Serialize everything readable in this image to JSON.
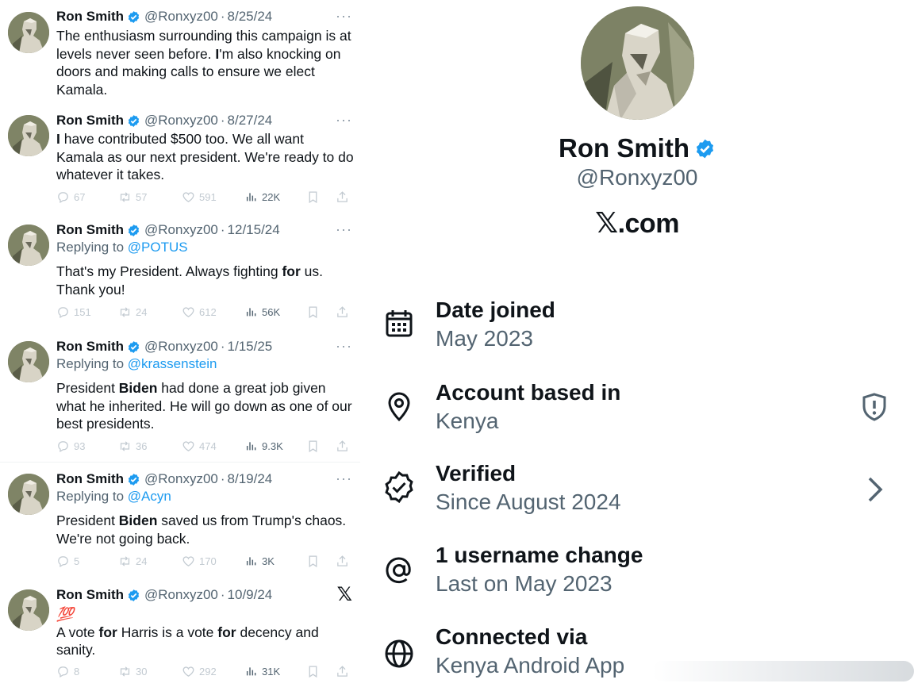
{
  "tweets": [
    {
      "name": "Ron Smith",
      "handle": "@Ronxyz00",
      "date": "8/25/24",
      "replying_prefix": "",
      "replying_to": "",
      "text": [
        "The enthusiasm surrounding this campaign is at",
        "levels never seen before. ",
        "I",
        "'m also knocking on",
        "doors and making calls to ensure we elect",
        "Kamala."
      ],
      "stats": null
    },
    {
      "name": "Ron Smith",
      "handle": "@Ronxyz00",
      "date": "8/27/24",
      "replying_prefix": "",
      "replying_to": "",
      "text": [
        "I",
        " have contributed $500 too. We all want",
        "Kamala as our next president. We're ready to do",
        "whatever it takes."
      ],
      "stats": {
        "replies": "67",
        "reposts": "57",
        "likes": "591",
        "views": "22K"
      }
    },
    {
      "name": "Ron Smith",
      "handle": "@Ronxyz00",
      "date": "12/15/24",
      "replying_prefix": "Replying to",
      "replying_to": "@POTUS",
      "text": [
        "That's my President. Always fighting ",
        "for",
        " us.",
        "Thank you!"
      ],
      "stats": {
        "replies": "151",
        "reposts": "24",
        "likes": "612",
        "views": "56K"
      }
    },
    {
      "name": "Ron Smith",
      "handle": "@Ronxyz00",
      "date": "1/15/25",
      "replying_prefix": "Replying to",
      "replying_to": "@krassenstein",
      "text": [
        "President ",
        "Biden",
        " had done a great job given",
        "what he inherited. He will go down as one of our",
        "best presidents."
      ],
      "stats": {
        "replies": "93",
        "reposts": "36",
        "likes": "474",
        "views": "9.3K"
      }
    },
    {
      "name": "Ron Smith",
      "handle": "@Ronxyz00",
      "date": "8/19/24",
      "replying_prefix": "Replying to",
      "replying_to": "@Acyn",
      "text": [
        "President ",
        "Biden",
        " saved us from Trump's chaos.",
        "We're not going back."
      ],
      "stats": {
        "replies": "5",
        "reposts": "24",
        "likes": "170",
        "views": "3K"
      }
    },
    {
      "name": "Ron Smith",
      "handle": "@Ronxyz00",
      "date": "10/9/24",
      "replying_prefix": "",
      "replying_to": "",
      "emoji": "💯",
      "text": [
        "A vote ",
        "for",
        " Harris is a vote ",
        "for",
        " decency and",
        "sanity."
      ],
      "stats": {
        "replies": "8",
        "reposts": "30",
        "likes": "292",
        "views": "31K"
      }
    }
  ],
  "more_glyph": "···",
  "x_glyph": "𝕏",
  "profile": {
    "name": "Ron Smith",
    "handle": "@Ronxyz00",
    "site_glyph": "𝕏",
    "site_suffix": ".com",
    "rows": [
      {
        "icon": "calendar-icon",
        "title": "Date joined",
        "value": "May 2023"
      },
      {
        "icon": "location-pin-icon",
        "title": "Account based in",
        "value": "Kenya"
      },
      {
        "icon": "verified-badge-icon",
        "title": "Verified",
        "value": "Since August 2024"
      },
      {
        "icon": "at-sign-icon",
        "title": "1 username change",
        "value": "Last on May 2023"
      },
      {
        "icon": "globe-icon",
        "title": "Connected via",
        "value": "Kenya Android App"
      }
    ]
  },
  "colors": {
    "verified_blue": "#1d9bf0",
    "link_blue": "#1d9bf0",
    "secondary_text": "#536471",
    "primary_text": "#0f1419"
  }
}
